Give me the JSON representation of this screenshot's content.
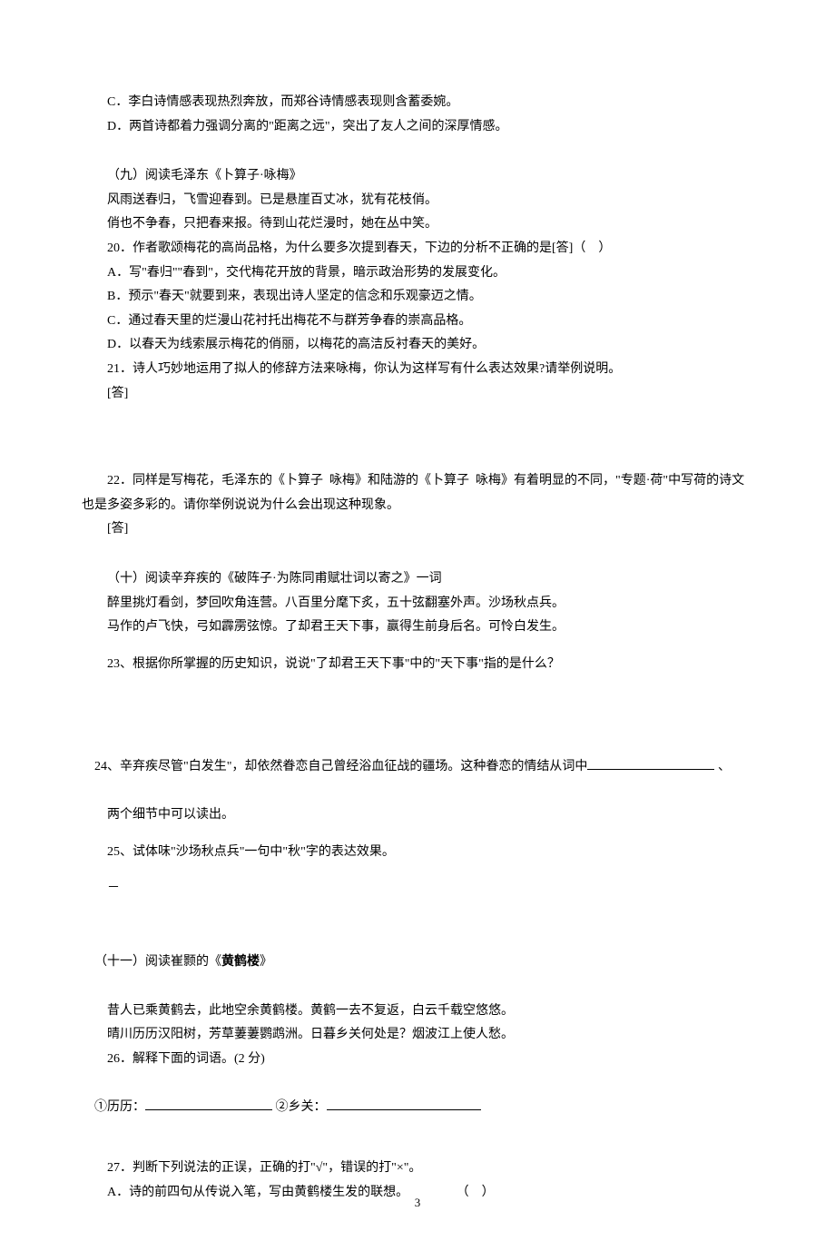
{
  "intro": {
    "lineC": "C．李白诗情感表现热烈奔放，而郑谷诗情感表现则含蓄委婉。",
    "lineD": "D．两首诗都着力强调分离的\"距离之远\"，突出了友人之间的深厚情感。"
  },
  "sec9": {
    "title": "（九）阅读毛泽东《卜算子·咏梅》",
    "poem1": "风雨送春归，飞雪迎春到。已是悬崖百丈冰，犹有花枝俏。",
    "poem2": "俏也不争春，只把春来报。待到山花烂漫时，她在丛中笑。",
    "q20": "20．作者歌颂梅花的高尚品格，为什么要多次提到春天，下边的分析不正确的是[答]（    ）",
    "q20A": "A．写\"春归\"\"春到\"，交代梅花开放的背景，暗示政治形势的发展变化。",
    "q20B": "B．预示\"春天\"就要到来，表现出诗人坚定的信念和乐观豪迈之情。",
    "q20C": "C．通过春天里的烂漫山花衬托出梅花不与群芳争春的崇高品格。",
    "q20D": "D．以春天为线索展示梅花的俏丽，以梅花的高洁反衬春天的美好。",
    "q21": "21．诗人巧妙地运用了拟人的修辞方法来咏梅，你认为这样写有什么表达效果?请举例说明。",
    "ans21": "[答]",
    "q22": "22．同样是写梅花，毛泽东的《卜算子  咏梅》和陆游的《卜算子  咏梅》有着明显的不同，\"专题·荷\"中写荷的诗文也是多姿多彩的。请你举例说说为什么会出现这种现象。",
    "ans22": "[答]"
  },
  "sec10": {
    "title": "（十）阅读辛弃疾的《破阵子·为陈同甫赋壮词以寄之》一词",
    "poem1": "醉里挑灯看剑，梦回吹角连营。八百里分麾下炙，五十弦翻塞外声。沙场秋点兵。",
    "poem2": "马作的卢飞快，弓如霹雳弦惊。了却君王天下事，赢得生前身后名。可怜白发生。",
    "q23": "23、根据你所掌握的历史知识，说说\"了却君王天下事\"中的\"天下事\"指的是什么？",
    "q24a": "24、辛弃疾尽管\"白发生\"，却依然眷恋自己曾经浴血征战的疆场。这种眷恋的情结从词中",
    "q24b": " 、",
    "q24c": "两个细节中可以读出。",
    "q25": "25、试体味\"沙场秋点兵\"一句中\"秋\"字的表达效果。",
    "dash": "－"
  },
  "sec11": {
    "title_pre": "（十一）阅读崔颢的《",
    "title_bold": "黄鹤楼",
    "title_post": "》",
    "poem1": "昔人已乘黄鹤去，此地空余黄鹤楼。黄鹤一去不复返，白云千载空悠悠。",
    "poem2": "晴川历历汉阳树，芳草萋萋鹦鹉洲。日暮乡关何处是？烟波江上使人愁。",
    "q26": "26．解释下面的词语。(2 分)",
    "q26_1": "①历历：",
    "q26_2": " ②乡关：",
    "q27": "27．判断下列说法的正误，正确的打\"√\"，错误的打\"×\"。",
    "q27A": "A．诗的前四句从传说入笔，写由黄鹤楼生发的联想。               （    ）"
  },
  "page": "3"
}
